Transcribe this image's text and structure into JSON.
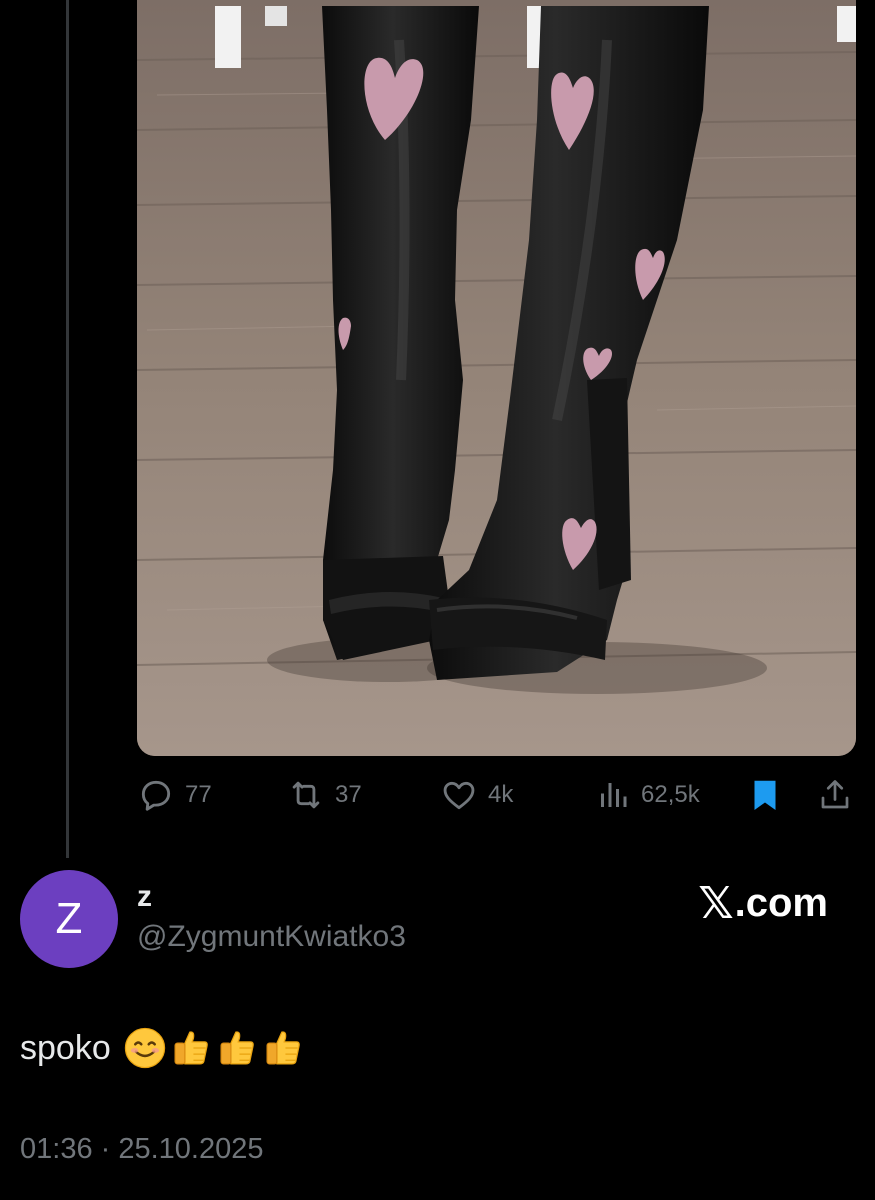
{
  "tweet_actions": {
    "replies": "77",
    "reposts": "37",
    "likes": "4k",
    "views": "62,5k",
    "icons": [
      "reply-icon",
      "repost-icon",
      "like-icon",
      "views-icon",
      "bookmark-icon",
      "share-icon"
    ]
  },
  "reply": {
    "avatar_letter": "Z",
    "display_name": "z",
    "handle": "@ZygmuntKwiatko3",
    "text": "spoko",
    "emojis": [
      "smiling-face",
      "thumbs-up",
      "thumbs-up",
      "thumbs-up"
    ],
    "timestamp": "01:36 · 25.10.2025"
  },
  "brand": {
    "mark": "𝕏",
    "domain": ".com"
  },
  "colors": {
    "background": "#000000",
    "muted_text": "#71767b",
    "primary_text": "#e7e9ea",
    "bookmark_active": "#1d9bf0",
    "avatar": "#6c3fc0",
    "heart_patch": "#c89aac"
  }
}
